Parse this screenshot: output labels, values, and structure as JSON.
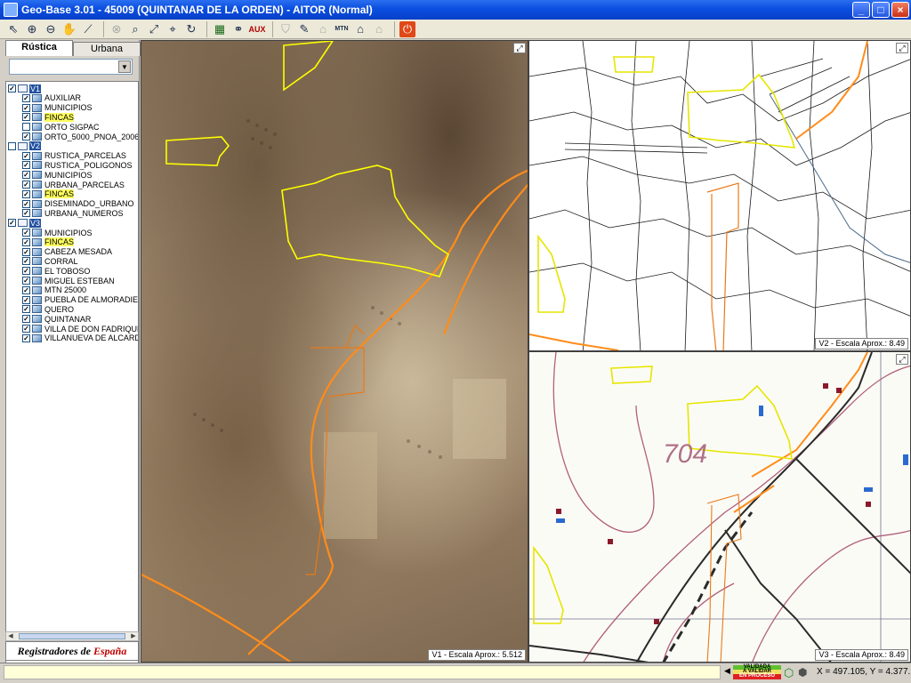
{
  "window": {
    "title": "Geo-Base  3.01  -  45009 (QUINTANAR DE LA ORDEN)  -  AITOR  (Normal)",
    "buttons": {
      "minimize": "_",
      "maximize": "□",
      "close": "×"
    }
  },
  "toolbar": {
    "items": [
      "select-arrow-icon",
      "zoom-in-icon",
      "zoom-out-icon",
      "pan-hand-icon",
      "measure-icon",
      "disabled-icon",
      "zoom-window-icon",
      "zoom-extents-icon",
      "zoom-previous-icon",
      "refresh-icon",
      "layers-icon",
      "binoculars-icon",
      "aux-icon",
      "shield-icon",
      "edit-icon",
      "building-icon",
      "mtn-icon",
      "house-icon",
      "house2-icon",
      "power-icon"
    ],
    "aux_label": "AUX",
    "mtn_label": "MTN"
  },
  "left_panel": {
    "tabs": [
      {
        "label": "Rústica",
        "active": true
      },
      {
        "label": "Urbana",
        "active": false
      }
    ],
    "combo_value": "",
    "tree": [
      {
        "label": "V1",
        "group": true,
        "checked": true
      },
      {
        "label": "AUXILIAR",
        "checked": true
      },
      {
        "label": "MUNICIPIOS",
        "checked": true
      },
      {
        "label": "FINCAS",
        "checked": true,
        "highlight": true
      },
      {
        "label": "ORTO SIGPAC",
        "checked": false
      },
      {
        "label": "ORTO_5000_PNOA_2006",
        "checked": true
      },
      {
        "label": "V2",
        "group": true,
        "checked": false
      },
      {
        "label": "RUSTICA_PARCELAS",
        "checked": true
      },
      {
        "label": "RUSTICA_POLIGONOS",
        "checked": true
      },
      {
        "label": "MUNICIPIOS",
        "checked": true
      },
      {
        "label": "URBANA_PARCELAS",
        "checked": true
      },
      {
        "label": "FINCAS",
        "checked": true,
        "highlight": true
      },
      {
        "label": "DISEMINADO_URBANO",
        "checked": true
      },
      {
        "label": "URBANA_NUMEROS",
        "checked": true
      },
      {
        "label": "V3",
        "group": true,
        "checked": true
      },
      {
        "label": "MUNICIPIOS",
        "checked": true
      },
      {
        "label": "FINCAS",
        "checked": true,
        "highlight": true
      },
      {
        "label": "CABEZA MESADA",
        "checked": true
      },
      {
        "label": "CORRAL",
        "checked": true
      },
      {
        "label": "EL TOBOSO",
        "checked": true
      },
      {
        "label": "MIGUEL ESTEBAN",
        "checked": true
      },
      {
        "label": "MTN 25000",
        "checked": true
      },
      {
        "label": "PUEBLA DE ALMORADIEL",
        "checked": true
      },
      {
        "label": "QUERO",
        "checked": true
      },
      {
        "label": "QUINTANAR",
        "checked": true
      },
      {
        "label": "VILLA DE DON FADRIQUE",
        "checked": true
      },
      {
        "label": "VILLANUEVA DE ALCARDETE",
        "checked": true
      }
    ],
    "logo": {
      "part1": "Registradores de ",
      "part2": "España"
    }
  },
  "views": {
    "v1": {
      "scale": "V1 - Escala Aprox.: 5.512"
    },
    "v2": {
      "scale": "V2 - Escala Aprox.: 8.49"
    },
    "v3": {
      "scale": "V3 - Escala Aprox.: 8.49",
      "contour_label": "704"
    }
  },
  "status": {
    "legend": {
      "validada": "VALIDADA",
      "a_validar": "A VALIDAR",
      "en_proceso": "EN PROCESO"
    },
    "coords": "X = 497.105, Y = 4.377.119"
  }
}
